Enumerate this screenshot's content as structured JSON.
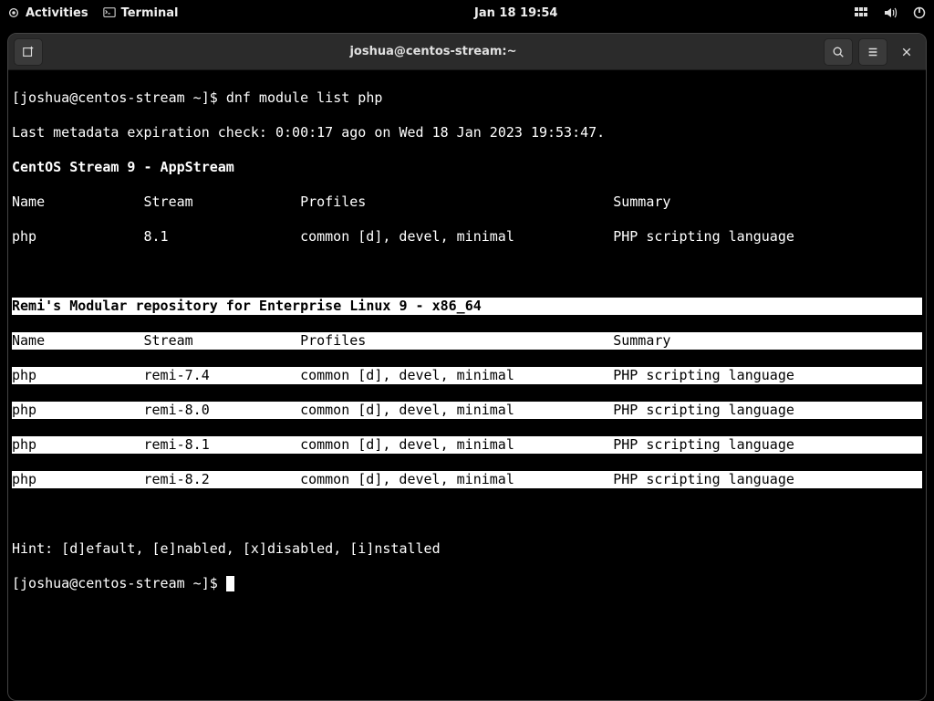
{
  "topbar": {
    "activities": "Activities",
    "app_label": "Terminal",
    "clock": "Jan 18  19:54"
  },
  "window": {
    "title": "joshua@centos-stream:~"
  },
  "term": {
    "prompt1": "[joshua@centos-stream ~]$ ",
    "cmd1": "dnf module list php",
    "meta_line": "Last metadata expiration check: 0:00:17 ago on Wed 18 Jan 2023 19:53:47.",
    "repo1_title": "CentOS Stream 9 - AppStream",
    "hdr_name": "Name",
    "hdr_stream": "Stream",
    "hdr_profiles": "Profiles",
    "hdr_summary": "Summary",
    "r1": {
      "name": "php",
      "stream": "8.1",
      "profiles": "common [d], devel, minimal",
      "summary": "PHP scripting language"
    },
    "repo2_title": "Remi's Modular repository for Enterprise Linux 9 - x86_64",
    "s1": {
      "name": "php",
      "stream": "remi-7.4",
      "profiles": "common [d], devel, minimal",
      "summary": "PHP scripting language"
    },
    "s2": {
      "name": "php",
      "stream": "remi-8.0",
      "profiles": "common [d], devel, minimal",
      "summary": "PHP scripting language"
    },
    "s3": {
      "name": "php",
      "stream": "remi-8.1",
      "profiles": "common [d], devel, minimal",
      "summary": "PHP scripting language"
    },
    "s4": {
      "name": "php",
      "stream": "remi-8.2",
      "profiles": "common [d], devel, minimal",
      "summary": "PHP scripting language"
    },
    "hint": "Hint: [d]efault, [e]nabled, [x]disabled, [i]nstalled",
    "prompt2": "[joshua@centos-stream ~]$ "
  }
}
